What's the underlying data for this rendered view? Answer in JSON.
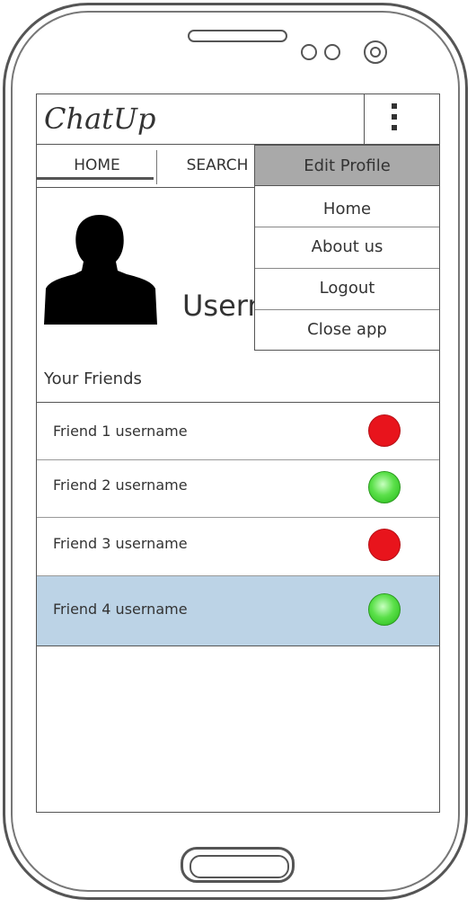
{
  "app": {
    "title": "ChatUp"
  },
  "tabs": [
    {
      "label": "HOME"
    },
    {
      "label": "SEARCH"
    }
  ],
  "profile": {
    "username_visible": "Usern"
  },
  "friends": {
    "heading": "Your Friends",
    "items": [
      {
        "name": "Friend 1 username",
        "status": "offline",
        "status_color": "#e8141c",
        "selected": false
      },
      {
        "name": "Friend 2 username",
        "status": "online",
        "status_color": "#4cd63c",
        "selected": false
      },
      {
        "name": "Friend 3 username",
        "status": "offline",
        "status_color": "#e8141c",
        "selected": false
      },
      {
        "name": "Friend 4 username",
        "status": "online",
        "status_color": "#4cd63c",
        "selected": true
      }
    ]
  },
  "menu": {
    "items": [
      {
        "label": "Edit Profile"
      },
      {
        "label": "Home"
      },
      {
        "label": "About us"
      },
      {
        "label": "Logout"
      },
      {
        "label": "Close app"
      }
    ]
  },
  "icons": {
    "overflow_menu": "vertical-dots-icon",
    "avatar": "person-silhouette-icon"
  },
  "colors": {
    "selected_row": "#bcd3e6",
    "menu_header": "#a9a9a9"
  }
}
